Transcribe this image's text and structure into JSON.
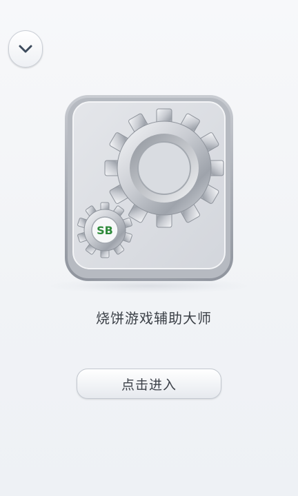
{
  "header": {
    "collapse_icon": "chevron-down-icon"
  },
  "app": {
    "icon": "gear-icon",
    "badge_text": "SB",
    "title": "烧饼游戏辅助大师"
  },
  "actions": {
    "enter_label": "点击进入"
  },
  "colors": {
    "background": "#f3f5f8",
    "badge_text": "#2e8a3a",
    "text": "#3a3f46"
  }
}
